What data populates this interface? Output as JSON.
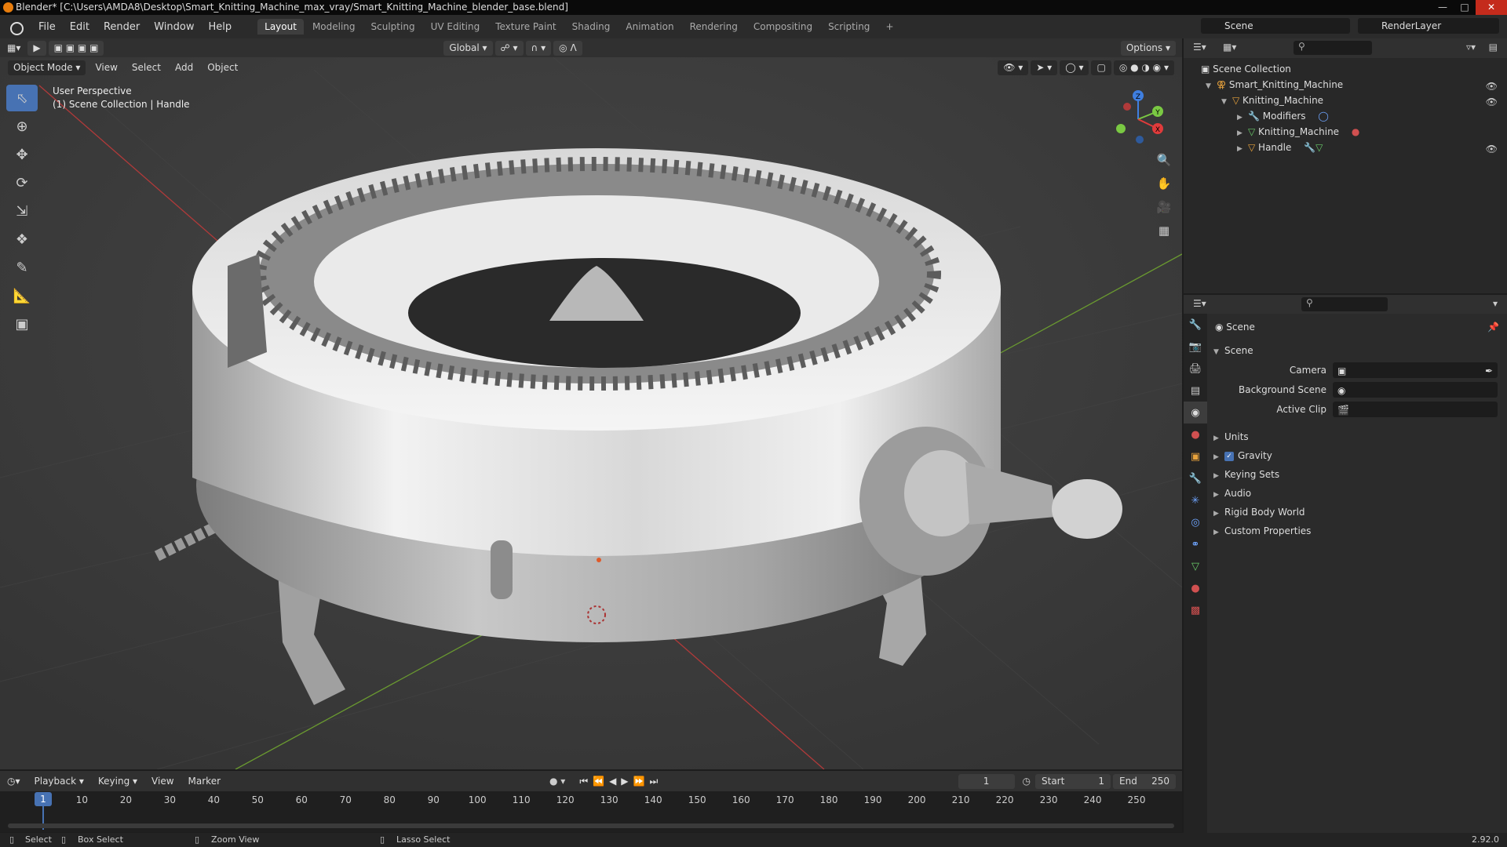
{
  "title": "Blender* [C:\\Users\\AMDA8\\Desktop\\Smart_Knitting_Machine_max_vray/Smart_Knitting_Machine_blender_base.blend]",
  "menu": [
    "File",
    "Edit",
    "Render",
    "Window",
    "Help"
  ],
  "workspaces": [
    "Layout",
    "Modeling",
    "Sculpting",
    "UV Editing",
    "Texture Paint",
    "Shading",
    "Animation",
    "Rendering",
    "Compositing",
    "Scripting"
  ],
  "active_workspace": "Layout",
  "scene_name": "Scene",
  "render_layer": "RenderLayer",
  "viewport": {
    "transform_orientation": "Global",
    "options_label": "Options",
    "mode": "Object Mode",
    "menus": [
      "View",
      "Select",
      "Add",
      "Object"
    ],
    "perspective": "User Perspective",
    "collection_info": "(1) Scene Collection | Handle",
    "gizmo": {
      "x": "X",
      "y": "Y",
      "z": "Z"
    }
  },
  "outliner": {
    "root": "Scene Collection",
    "items": [
      {
        "label": "Smart_Knitting_Machine",
        "indent": 1,
        "icon_color": "#e8a23c"
      },
      {
        "label": "Knitting_Machine",
        "indent": 2,
        "icon_color": "#e8a23c"
      },
      {
        "label": "Modifiers",
        "indent": 3,
        "icon_color": "#6fa5ff"
      },
      {
        "label": "Knitting_Machine",
        "indent": 3,
        "icon_color": "#6acb6a"
      },
      {
        "label": "Handle",
        "indent": 3,
        "icon_color": "#e8a23c"
      }
    ]
  },
  "properties": {
    "context": "Scene",
    "section": "Scene",
    "fields": [
      {
        "label": "Camera"
      },
      {
        "label": "Background Scene"
      },
      {
        "label": "Active Clip"
      }
    ],
    "panels": [
      "Units",
      "Gravity",
      "Keying Sets",
      "Audio",
      "Rigid Body World",
      "Custom Properties"
    ],
    "gravity_checked": true
  },
  "timeline": {
    "menus": [
      "Playback",
      "Keying",
      "View",
      "Marker"
    ],
    "current_frame": "1",
    "start_label": "Start",
    "start": "1",
    "end_label": "End",
    "end": "250",
    "ticks": [
      10,
      20,
      30,
      40,
      50,
      60,
      70,
      80,
      90,
      100,
      110,
      120,
      130,
      140,
      150,
      160,
      170,
      180,
      190,
      200,
      210,
      220,
      230,
      240,
      250
    ],
    "cursor_frame": "1"
  },
  "status": {
    "select": "Select",
    "box_select": "Box Select",
    "zoom_view": "Zoom View",
    "lasso_select": "Lasso Select",
    "version": "2.92.0"
  },
  "colors": {
    "accent": "#4772b3",
    "x_axis": "#e03b3b",
    "y_axis": "#7ac943",
    "z_axis": "#3f7fe0"
  }
}
